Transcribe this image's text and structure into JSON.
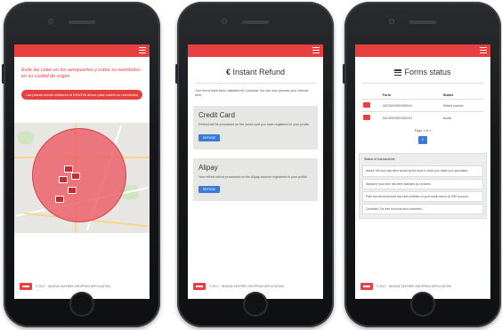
{
  "screen1": {
    "heading": "Evite las colas en los aeropuertos y cobre su reembolso en su ciudad de origen",
    "cta": "Las plazas donde adhieren al INNOVA ahora para cobrar su reembolso",
    "footer": "© 2017 · INNOVA TAXFREE SHOPPING APPLICATION"
  },
  "screen2": {
    "title_symbol": "€",
    "title": "Instant Refund",
    "intro": "Your forms have been validated by Customs! You can now process your refunds here.",
    "cards": [
      {
        "title": "Credit Card",
        "text": "Refund will be processed on the credit card you have registered in your profile.",
        "button": "REFUND"
      },
      {
        "title": "Alipay",
        "text": "Your refund will be processed on the Alipay account registered in your profile.",
        "button": "REFUND"
      }
    ],
    "footer": "© 2017 · INNOVA TAXFREE SHOPPING APPLICATION"
  },
  "screen3": {
    "title": "Forms status",
    "columns": [
      "Form",
      "Status"
    ],
    "rows": [
      {
        "form": "3421000000000000010",
        "status": "Refund proceed"
      },
      {
        "form": "3421000000000000011",
        "status": "Issued"
      }
    ],
    "pager": "Page 1 of 1",
    "pager_current": "1",
    "status_header": "Status of transactions",
    "status_items": [
      "Issued: the form has been issued by the store in which you made your purchases",
      "Stamped: your form has been stamped by Customs",
      "Paid: the refund amount has been credited on your credit card or ALIPAY account",
      "Cancelled: Tax free form has been cancelled"
    ],
    "footer": "© 2017 · INNOVA TAXFREE SHOPPING APPLICATION"
  },
  "colors": {
    "accent": "#e84040",
    "button_blue": "#3a7bd5",
    "card_bg": "#e6e7e5"
  }
}
